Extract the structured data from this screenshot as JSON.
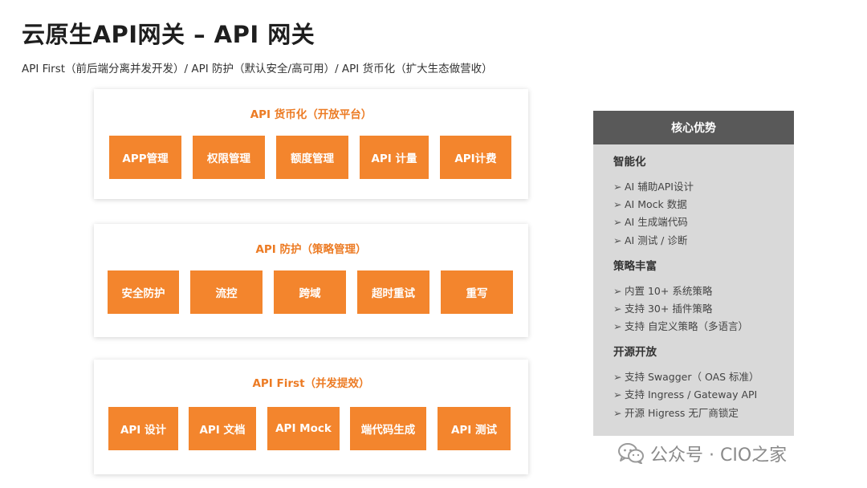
{
  "title": "云原生API网关 – API 网关",
  "subtitle": "API First（前后端分离并发开发）/ API 防护（默认安全/高可用）/ API 货币化（扩大生态做营收）",
  "panels": [
    {
      "title": "API 货币化（开放平台）",
      "buttons": [
        "APP管理",
        "权限管理",
        "额度管理",
        "API 计量",
        "API计费"
      ]
    },
    {
      "title": "API 防护（策略管理）",
      "buttons": [
        "安全防护",
        "流控",
        "跨域",
        "超时重试",
        "重写"
      ]
    },
    {
      "title": "API First（并发提效）",
      "buttons": [
        "API 设计",
        "API 文档",
        "API Mock",
        "端代码生成",
        "API 测试"
      ]
    }
  ],
  "advantages": {
    "header": "核心优势",
    "groups": [
      {
        "title": "智能化",
        "items": [
          "AI 辅助API设计",
          "AI Mock 数据",
          "AI 生成端代码",
          "AI 测试 / 诊断"
        ]
      },
      {
        "title": "策略丰富",
        "items": [
          "内置 10+ 系统策略",
          "支持 30+ 插件策略",
          "支持 自定义策略（多语言）"
        ]
      },
      {
        "title": "开源开放",
        "items": [
          "支持 Swagger（ OAS 标准）",
          "支持 Ingress / Gateway API",
          "开源 Higress 无厂商锁定"
        ]
      }
    ],
    "arrow": "➢"
  },
  "watermark": "公众号 · CIO之家",
  "colors": {
    "accent": "#f3852d",
    "accent_text": "#ec7b24",
    "side_header": "#595959",
    "side_bg": "#d9d9d9"
  },
  "icons": {
    "watermark": "wechat-icon"
  }
}
